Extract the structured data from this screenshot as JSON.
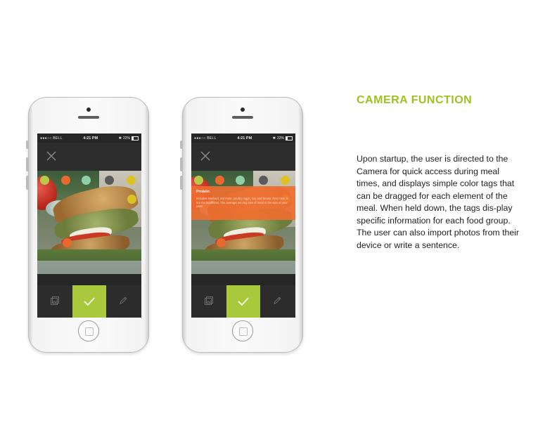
{
  "colors": {
    "accent": "#A9C93C",
    "tag_yellow_green": "#B7C948",
    "tag_orange": "#E8692E",
    "tag_mint": "#8FCFA6",
    "tag_grey": "#5A5A5A",
    "tag_yellow": "#DEC224",
    "overlay_orange": "#EF6E2F",
    "heading_color": "#9CC21E"
  },
  "status_bar": {
    "carrier": "●●●○○ BELL",
    "time": "4:21 PM",
    "battery": "22%"
  },
  "tags": [
    {
      "color": "#B7C948",
      "icon": "circle-tag"
    },
    {
      "color": "#E8692E",
      "icon": "circle-tag"
    },
    {
      "color": "#8FCFA6",
      "icon": "circle-tag"
    },
    {
      "color": "#5A5A5A",
      "icon": "circle-tag"
    },
    {
      "color": "#DEC224",
      "icon": "circle-tag"
    }
  ],
  "icons": {
    "close": "close-icon",
    "gallery": "gallery-icon",
    "confirm": "checkmark-icon",
    "write": "pencil-icon"
  },
  "info_popup": {
    "title": "Protein",
    "body": "Includes seafood, red meat, poultry, eggs, soy and beans. Red meat is not the healthiest. The average serving size of meat is the size of your palm."
  },
  "text": {
    "heading": "CAMERA FUNCTION",
    "description": "Upon startup, the user is directed to the Camera for quick access during meal times, and displays simple color tags that can be dragged for each element of the meal. When held down, the tags dis-play specific information for each food group. The user can also import photos from their device or write a sentence."
  }
}
